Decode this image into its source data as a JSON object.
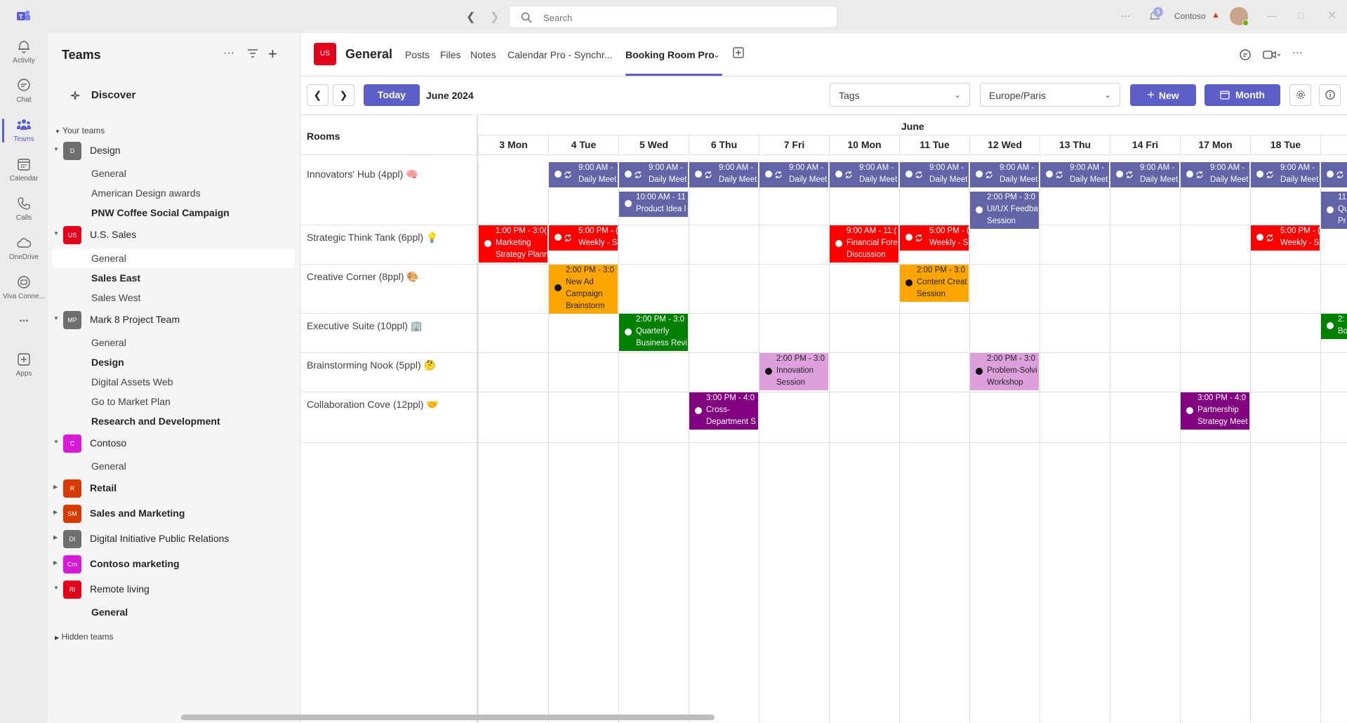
{
  "titlebar": {
    "search_placeholder": "Search",
    "org_name": "Contoso",
    "notification_count": "9"
  },
  "rail": {
    "items": [
      {
        "label": "Activity",
        "icon": "bell-icon"
      },
      {
        "label": "Chat",
        "icon": "chat-icon"
      },
      {
        "label": "Teams",
        "icon": "teams-icon"
      },
      {
        "label": "Calendar",
        "icon": "calendar-icon"
      },
      {
        "label": "Calls",
        "icon": "phone-icon"
      },
      {
        "label": "OneDrive",
        "icon": "cloud-icon"
      },
      {
        "label": "Viva Conne...",
        "icon": "viva-icon"
      },
      {
        "label": "...",
        "icon": "more-icon"
      },
      {
        "label": "Apps",
        "icon": "apps-icon"
      }
    ]
  },
  "teams_panel": {
    "title": "Teams",
    "discover": "Discover",
    "your_teams": "Your teams",
    "hidden_teams": "Hidden teams",
    "teams": [
      {
        "name": "Design",
        "initials": "D",
        "color": "#6e6e6e",
        "bold": false,
        "channels": [
          {
            "name": "General",
            "bold": false
          },
          {
            "name": "American Design awards",
            "bold": false
          },
          {
            "name": "PNW Coffee Social Campaign",
            "bold": true
          }
        ]
      },
      {
        "name": "U.S. Sales",
        "initials": "US",
        "color": "#e3001b",
        "bold": false,
        "channels": [
          {
            "name": "General",
            "bold": false,
            "selected": true
          },
          {
            "name": "Sales East",
            "bold": true
          },
          {
            "name": "Sales West",
            "bold": false
          }
        ]
      },
      {
        "name": "Mark 8 Project Team",
        "initials": "MP",
        "color": "#6e6e6e",
        "bold": false,
        "channels": [
          {
            "name": "General",
            "bold": false
          },
          {
            "name": "Design",
            "bold": true
          },
          {
            "name": "Digital Assets Web",
            "bold": false
          },
          {
            "name": "Go to Market Plan",
            "bold": false
          },
          {
            "name": "Research and Development",
            "bold": true
          }
        ]
      },
      {
        "name": "Contoso",
        "initials": "C",
        "color": "#d61ad6",
        "bold": false,
        "channels": [
          {
            "name": "General",
            "bold": false
          }
        ]
      },
      {
        "name": "Retail",
        "initials": "R",
        "color": "#d83b01",
        "bold": true,
        "channels": []
      },
      {
        "name": "Sales and Marketing",
        "initials": "SM",
        "color": "#d83b01",
        "bold": true,
        "channels": []
      },
      {
        "name": "Digital Initiative Public Relations",
        "initials": "DI",
        "color": "#6e6e6e",
        "bold": false,
        "channels": []
      },
      {
        "name": "Contoso marketing",
        "initials": "Cm",
        "color": "#d61ad6",
        "bold": true,
        "channels": []
      },
      {
        "name": "Remote living",
        "initials": "Rl",
        "color": "#e3001b",
        "bold": false,
        "channels": [
          {
            "name": "General",
            "bold": true
          }
        ]
      }
    ]
  },
  "channel": {
    "avatar": "US",
    "title": "General",
    "tabs": [
      "Posts",
      "Files",
      "Notes",
      "Calendar Pro - Synchr...",
      "Booking Room Pro"
    ],
    "active_tab": "Booking Room Pro"
  },
  "toolbar": {
    "today": "Today",
    "month_label": "June 2024",
    "tags_placeholder": "Tags",
    "timezone": "Europe/Paris",
    "new_label": "New",
    "view_label": "Month"
  },
  "calendar": {
    "rooms_header": "Rooms",
    "month_heading": "June",
    "days": [
      "3 Mon",
      "4 Tue",
      "5 Wed",
      "6 Thu",
      "7 Fri",
      "10 Mon",
      "11 Tue",
      "12 Wed",
      "13 Thu",
      "14 Fri",
      "17 Mon",
      "18 Tue",
      "19"
    ],
    "rooms": [
      "Innovators' Hub (4ppl) 🧠",
      "Strategic Think Tank (6ppl) 💡",
      "Creative Corner (8ppl) 🎨",
      "Executive Suite (10ppl) 🏢",
      "Brainstorming Nook (5ppl) 🤔",
      "Collaboration Cove (12ppl) 🤝"
    ],
    "colors": {
      "purple": "#6264a7",
      "red": "#ff0000",
      "orange": "#ffa500",
      "green": "#008000",
      "pink": "#dda0dd",
      "magenta": "#800080"
    },
    "events": [
      {
        "room": 0,
        "day": 1,
        "lane": 0,
        "color": "purple",
        "recurring": true,
        "lines": [
          "9:00 AM -",
          "Daily Meet"
        ]
      },
      {
        "room": 0,
        "day": 2,
        "lane": 0,
        "color": "purple",
        "recurring": true,
        "lines": [
          "9:00 AM -",
          "Daily Meet"
        ]
      },
      {
        "room": 0,
        "day": 3,
        "lane": 0,
        "color": "purple",
        "recurring": true,
        "lines": [
          "9:00 AM -",
          "Daily Meet"
        ]
      },
      {
        "room": 0,
        "day": 4,
        "lane": 0,
        "color": "purple",
        "recurring": true,
        "lines": [
          "9:00 AM -",
          "Daily Meet"
        ]
      },
      {
        "room": 0,
        "day": 5,
        "lane": 0,
        "color": "purple",
        "recurring": true,
        "lines": [
          "9:00 AM -",
          "Daily Meet"
        ]
      },
      {
        "room": 0,
        "day": 6,
        "lane": 0,
        "color": "purple",
        "recurring": true,
        "lines": [
          "9:00 AM -",
          "Daily Meet"
        ]
      },
      {
        "room": 0,
        "day": 7,
        "lane": 0,
        "color": "purple",
        "recurring": true,
        "lines": [
          "9:00 AM -",
          "Daily Meet"
        ]
      },
      {
        "room": 0,
        "day": 8,
        "lane": 0,
        "color": "purple",
        "recurring": true,
        "lines": [
          "9:00 AM -",
          "Daily Meet"
        ]
      },
      {
        "room": 0,
        "day": 9,
        "lane": 0,
        "color": "purple",
        "recurring": true,
        "lines": [
          "9:00 AM -",
          "Daily Meet"
        ]
      },
      {
        "room": 0,
        "day": 10,
        "lane": 0,
        "color": "purple",
        "recurring": true,
        "lines": [
          "9:00 AM -",
          "Daily Meet"
        ]
      },
      {
        "room": 0,
        "day": 11,
        "lane": 0,
        "color": "purple",
        "recurring": true,
        "lines": [
          "9:00 AM -",
          "Daily Meet"
        ]
      },
      {
        "room": 0,
        "day": 12,
        "lane": 0,
        "color": "purple",
        "recurring": true,
        "lines": [
          "",
          ""
        ]
      },
      {
        "room": 0,
        "day": 2,
        "lane": 1,
        "color": "purple",
        "recurring": false,
        "lines": [
          "10:00 AM - 11",
          "Product Idea I"
        ]
      },
      {
        "room": 0,
        "day": 7,
        "lane": 1,
        "color": "purple",
        "recurring": false,
        "lines": [
          "2:00 PM - 3:0",
          "UI/UX Feedba",
          "Session"
        ]
      },
      {
        "room": 0,
        "day": 12,
        "lane": 1,
        "color": "purple",
        "recurring": false,
        "lines": [
          "11",
          "Qu",
          "Pr"
        ]
      },
      {
        "room": 1,
        "day": 0,
        "lane": 0,
        "color": "red",
        "recurring": false,
        "lines": [
          "1:00 PM - 3:0(",
          "Marketing",
          "Strategy Plann"
        ]
      },
      {
        "room": 1,
        "day": 1,
        "lane": 0,
        "color": "red",
        "recurring": true,
        "lines": [
          "5:00 PM - (",
          "Weekly - S"
        ]
      },
      {
        "room": 1,
        "day": 5,
        "lane": 0,
        "color": "red",
        "recurring": false,
        "lines": [
          "9:00 AM - 11:(",
          "Financial Fore",
          "Discussion"
        ]
      },
      {
        "room": 1,
        "day": 6,
        "lane": 0,
        "color": "red",
        "recurring": true,
        "lines": [
          "5:00 PM - (",
          "Weekly - S"
        ]
      },
      {
        "room": 1,
        "day": 11,
        "lane": 0,
        "color": "red",
        "recurring": true,
        "lines": [
          "5:00 PM - (",
          "Weekly - S"
        ]
      },
      {
        "room": 2,
        "day": 1,
        "lane": 0,
        "color": "orange",
        "recurring": false,
        "lines": [
          "2:00 PM - 3:0",
          "New Ad",
          "Campaign",
          "Brainstorm"
        ]
      },
      {
        "room": 2,
        "day": 6,
        "lane": 0,
        "color": "orange",
        "recurring": false,
        "lines": [
          "2:00 PM - 3:0",
          "Content Creat",
          "Session"
        ]
      },
      {
        "room": 3,
        "day": 2,
        "lane": 0,
        "color": "green",
        "recurring": false,
        "lines": [
          "2:00 PM - 3:0",
          "Quarterly",
          "Business Revi"
        ]
      },
      {
        "room": 3,
        "day": 12,
        "lane": 0,
        "color": "green",
        "recurring": false,
        "lines": [
          "2:",
          "Bo"
        ]
      },
      {
        "room": 4,
        "day": 4,
        "lane": 0,
        "color": "pink",
        "recurring": false,
        "lines": [
          "2:00 PM - 3:0",
          "Innovation",
          "Session"
        ]
      },
      {
        "room": 4,
        "day": 7,
        "lane": 0,
        "color": "pink",
        "recurring": false,
        "lines": [
          "2:00 PM - 3:0",
          "Problem-Solvi",
          "Workshop"
        ]
      },
      {
        "room": 5,
        "day": 3,
        "lane": 0,
        "color": "magenta",
        "recurring": false,
        "lines": [
          "3:00 PM - 4:0",
          "Cross-",
          "Department S"
        ]
      },
      {
        "room": 5,
        "day": 10,
        "lane": 0,
        "color": "magenta",
        "recurring": false,
        "lines": [
          "3:00 PM - 4:0",
          "Partnership",
          "Strategy Meet"
        ]
      }
    ]
  }
}
